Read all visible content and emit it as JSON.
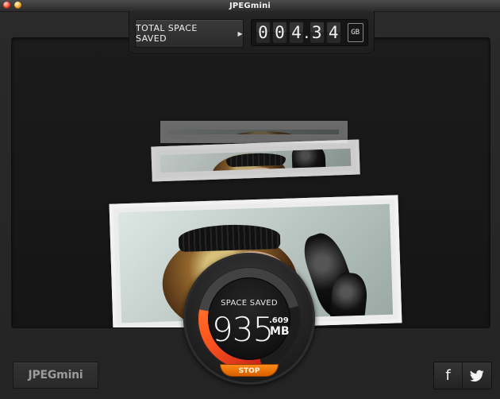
{
  "window": {
    "title": "JPEGmini"
  },
  "total": {
    "label": "TOTAL SPACE SAVED",
    "digits": [
      "0",
      "0",
      "4",
      ".",
      "3",
      "4"
    ],
    "unit": "GB"
  },
  "gauge": {
    "label": "SPACE SAVED",
    "main_value": "935",
    "decimal_value": ".609",
    "unit": "MB",
    "progress": 0.38,
    "stop_label": "STOP"
  },
  "footer": {
    "logo": "JPEGmini",
    "facebook": "f"
  },
  "icons": {
    "close": "close-icon",
    "minimize": "minimize-icon",
    "play": "play-icon",
    "facebook": "facebook-icon",
    "twitter": "twitter-icon"
  },
  "colors": {
    "accent": "#ff6b2a",
    "stop": "#ff8c18",
    "close": "#ff5a38",
    "minimize": "#ffb13b"
  }
}
